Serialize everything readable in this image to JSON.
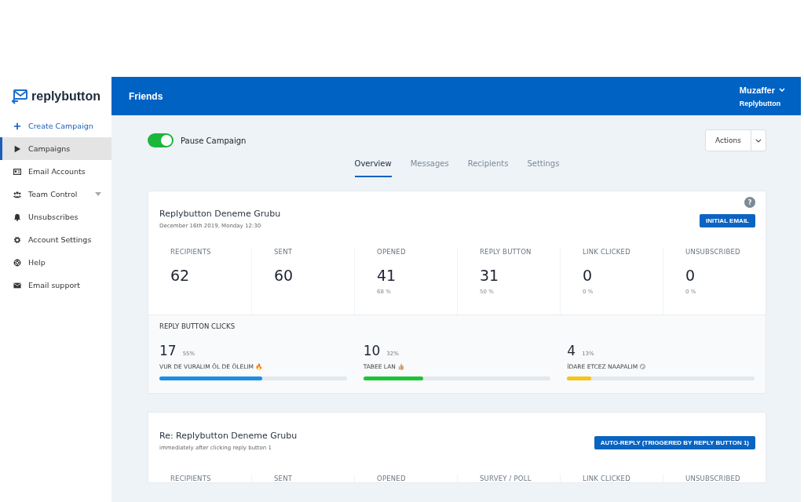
{
  "logo": {
    "text": "replybutton"
  },
  "sidebar": {
    "items": [
      {
        "label": "Create Campaign",
        "kind": "action",
        "selected": false
      },
      {
        "label": "Campaigns",
        "kind": "link",
        "selected": true
      },
      {
        "label": "Email Accounts",
        "kind": "link",
        "selected": false
      },
      {
        "label": "Team Control",
        "kind": "link",
        "selected": false,
        "expandable": true
      },
      {
        "label": "Unsubscribes",
        "kind": "link",
        "selected": false
      },
      {
        "label": "Account Settings",
        "kind": "link",
        "selected": false
      },
      {
        "label": "Help",
        "kind": "link",
        "selected": false
      },
      {
        "label": "Email support",
        "kind": "link",
        "selected": false
      }
    ]
  },
  "header": {
    "title": "Friends",
    "user": "Muzaffer",
    "company": "Replybutton"
  },
  "pause_toggle": {
    "label": "Pause Campaign",
    "on": true
  },
  "actions_button": {
    "label": "Actions"
  },
  "tabs": [
    {
      "label": "Overview",
      "selected": true
    },
    {
      "label": "Messages",
      "selected": false
    },
    {
      "label": "Recipients",
      "selected": false
    },
    {
      "label": "Settings",
      "selected": false
    }
  ],
  "cards": [
    {
      "title": "Replybutton Deneme Grubu",
      "subtitle": "December 16th 2019, Monday 12:30",
      "help": "?",
      "badge": "INITIAL EMAIL",
      "stats": [
        {
          "label": "RECIPIENTS",
          "value": "62"
        },
        {
          "label": "SENT",
          "value": "60"
        },
        {
          "label": "OPENED",
          "value": "41",
          "percent": "68 %"
        },
        {
          "label": "REPLY BUTTON",
          "value": "31",
          "percent": "50 %"
        },
        {
          "label": "LINK CLICKED",
          "value": "0",
          "percent": "0 %"
        },
        {
          "label": "UNSUBSCRIBED",
          "value": "0",
          "percent": "0 %"
        }
      ],
      "clicks": {
        "title": "REPLY BUTTON CLICKS",
        "items": [
          {
            "count": "17",
            "percent": "55%",
            "label": "VUR DE VURALIM ÖL DE ÖLELIM 🔥",
            "level": 0.55,
            "color": "#1a8fe3"
          },
          {
            "count": "10",
            "percent": "32%",
            "label": "TABEE LAN 👍🏼",
            "level": 0.32,
            "color": "#1ec337"
          },
          {
            "count": "4",
            "percent": "13%",
            "label": "İDARE ETCEZ NAAPALIM 😏",
            "level": 0.13,
            "color": "#f5c518"
          }
        ]
      }
    },
    {
      "title": "Re: Replybutton Deneme Grubu",
      "subtitle": "immediately after clicking reply button 1",
      "badge": "AUTO-REPLY (TRIGGERED BY REPLY BUTTON 1)",
      "stats": [
        {
          "label": "RECIPIENTS"
        },
        {
          "label": "SENT"
        },
        {
          "label": "OPENED"
        },
        {
          "label": "SURVEY / POLL"
        },
        {
          "label": "LINK CLICKED"
        },
        {
          "label": "UNSUBSCRIBED"
        }
      ]
    }
  ]
}
